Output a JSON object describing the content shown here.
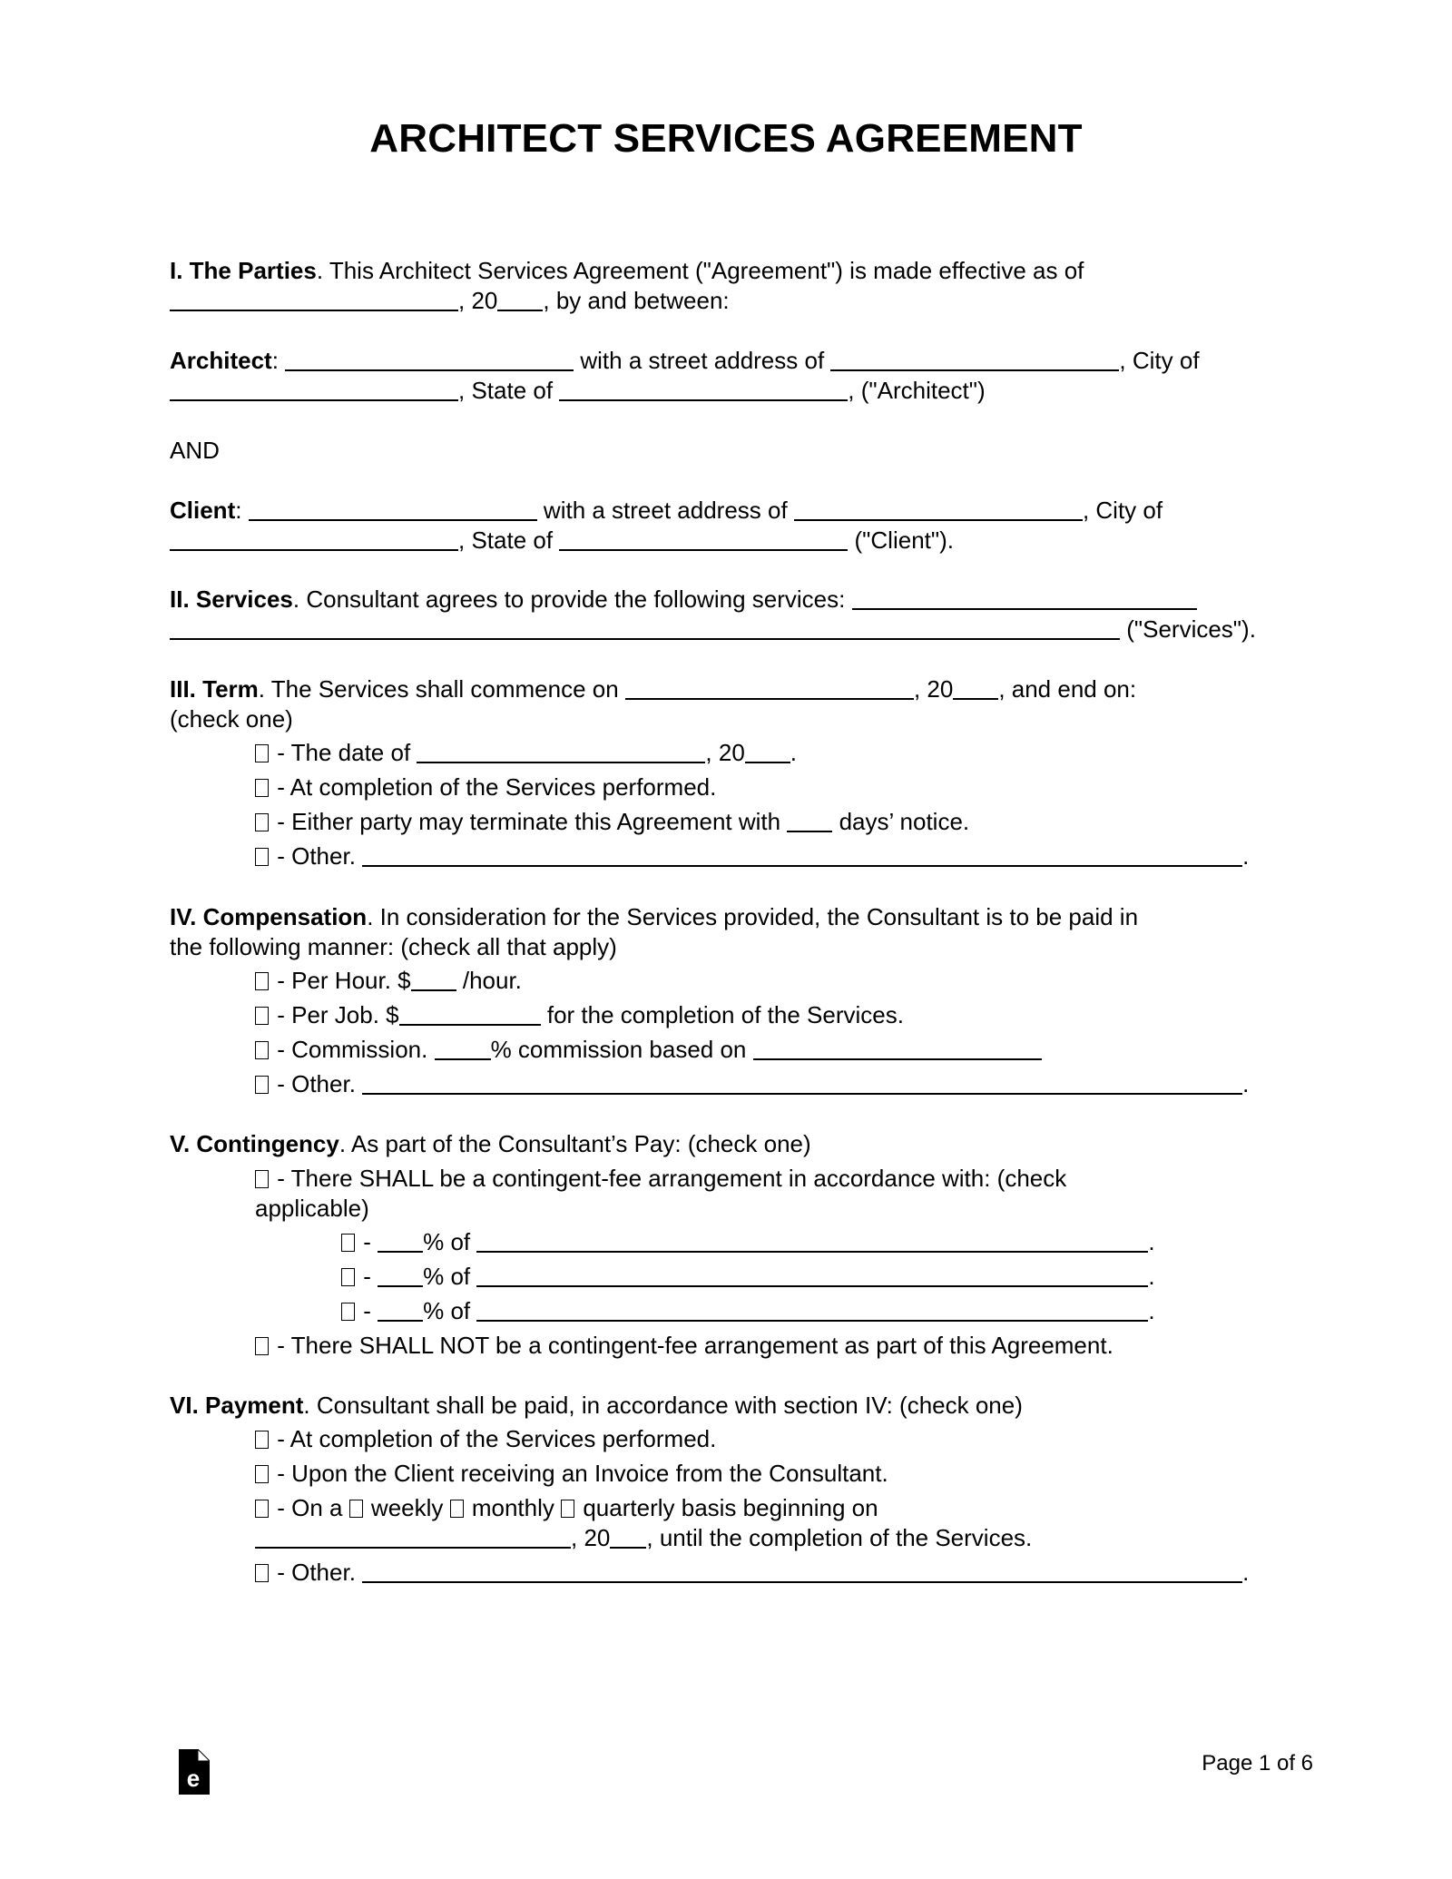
{
  "document": {
    "title": "ARCHITECT SERVICES AGREEMENT",
    "page_label": "Page 1 of 6",
    "logo_icon": "document-e-logo-icon"
  },
  "sections": {
    "parties": {
      "heading": "I. The Parties",
      "text_1": ". This Architect Services Agreement (\"Agreement\") is made effective as of",
      "text_2": ", 20",
      "text_3": ", by and between:",
      "architect_label": "Architect",
      "architect_1": ": ",
      "architect_2": " with a street address of ",
      "architect_3": ", City of",
      "architect_4": ", State of ",
      "architect_5": ", (\"Architect\")",
      "and": "AND",
      "client_label": "Client",
      "client_1": ": ",
      "client_2": " with a street address of ",
      "client_3": ", City of",
      "client_4": ", State of ",
      "client_5": " (\"Client\")."
    },
    "services": {
      "heading": "II. Services",
      "text_1": ". Consultant agrees to provide the following services: ",
      "text_2": " (\"Services\")."
    },
    "term": {
      "heading": "III. Term",
      "text_1": ". The Services shall commence on ",
      "text_2": ", 20",
      "text_3": ", and end on:",
      "text_4": "(check one)",
      "options": [
        {
          "a": " - The date of ",
          "b": ", 20",
          "c": "."
        },
        {
          "a": " - At completion of the Services performed."
        },
        {
          "a": " - Either party may terminate this Agreement with ",
          "b": " days’ notice."
        },
        {
          "a": " - Other. ",
          "b": "."
        }
      ]
    },
    "compensation": {
      "heading": "IV. Compensation",
      "text_1": ". In consideration for the Services provided, the Consultant is to be paid in",
      "text_2": "the following manner: (check all that apply)",
      "options": [
        {
          "a": " - Per Hour. $",
          "b": " /hour."
        },
        {
          "a": " - Per Job. $",
          "b": " for the completion of the Services."
        },
        {
          "a": " - Commission. ",
          "b": "% commission based on "
        },
        {
          "a": " - Other. ",
          "b": "."
        }
      ]
    },
    "contingency": {
      "heading": "V. Contingency",
      "text_1": ". As part of the Consultant’s Pay: (check one)",
      "shall_1": " - There SHALL be a contingent-fee arrangement in accordance with: (check",
      "shall_2": "applicable)",
      "sub_a": " - ",
      "sub_b": "% of ",
      "sub_c": ".",
      "shall_not": " - There SHALL NOT be a contingent-fee arrangement as part of this Agreement."
    },
    "payment": {
      "heading": "VI. Payment",
      "text_1": ". Consultant shall be paid, in accordance with section IV: (check one)",
      "opt_1": " - At completion of the Services performed.",
      "opt_2": " - Upon the Client receiving an Invoice from the Consultant.",
      "opt_3_a": " - On a ",
      "opt_3_weekly": " weekly ",
      "opt_3_monthly": " monthly ",
      "opt_3_quarterly": " quarterly basis beginning on",
      "opt_3_line2_a": ", 20",
      "opt_3_line2_b": ", until the completion of the Services.",
      "opt_4_a": " - Other. ",
      "opt_4_b": "."
    }
  }
}
